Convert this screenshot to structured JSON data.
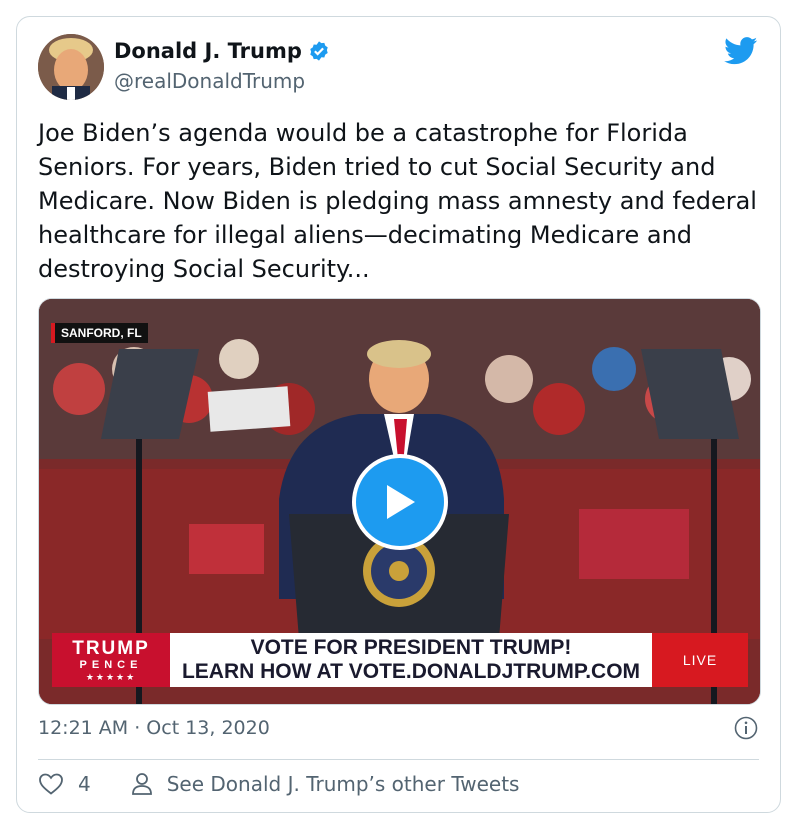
{
  "tweet": {
    "author_name": "Donald J. Trump",
    "handle": "@realDonaldTrump",
    "text": "Joe Biden’s agenda would be a catastrophe for Florida Seniors. For years, Biden tried to cut Social Security and Medicare. Now Biden is pledging mass amnesty and federal healthcare for illegal aliens—decimating Medicare and destroying Social Security...",
    "timestamp": "12:21 AM · Oct 13, 2020",
    "like_count": "4",
    "other_tweets_label": "See Donald J. Trump’s other Tweets"
  },
  "video": {
    "location": "SANFORD, FL",
    "banner_brand_line1": "TRUMP",
    "banner_brand_line2": "PENCE",
    "banner_brand_stars": "★★★★★",
    "banner_line1": "VOTE FOR PRESIDENT TRUMP!",
    "banner_line2": "LEARN HOW AT VOTE.DONALDJTRUMP.COM",
    "banner_live": "LIVE"
  },
  "icons": {
    "verified": "verified-badge-icon",
    "brand": "twitter-bird-icon",
    "play": "play-icon",
    "info": "info-icon",
    "like": "heart-icon",
    "profile": "person-icon"
  },
  "colors": {
    "accent": "#1d9bf0",
    "text": "#0f1419",
    "muted": "#536471",
    "border": "#cfd9de",
    "banner_red": "#c8102e"
  }
}
